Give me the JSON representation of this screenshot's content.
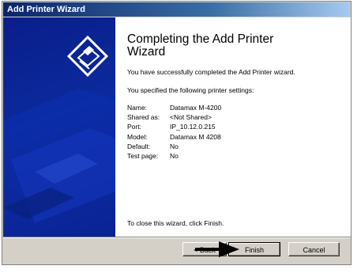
{
  "window": {
    "title": "Add Printer Wizard"
  },
  "heading_line1": "Completing the Add Printer",
  "heading_line2": "Wizard",
  "intro": "You have successfully completed the Add Printer wizard.",
  "specified": "You specified the following printer settings:",
  "settings": [
    {
      "label": "Name:",
      "value": "Datamax M-4200"
    },
    {
      "label": "Shared as:",
      "value": "<Not Shared>"
    },
    {
      "label": "Port:",
      "value": "IP_10.12.0.215"
    },
    {
      "label": "Model:",
      "value": "Datamax M 4208"
    },
    {
      "label": "Default:",
      "value": "No"
    },
    {
      "label": "Test page:",
      "value": "No"
    }
  ],
  "closing": "To close this wizard, click Finish.",
  "buttons": {
    "back": "< Back",
    "finish": "Finish",
    "cancel": "Cancel"
  },
  "colors": {
    "sidebar": "#0b2a9e",
    "titlebar": "#0a246a"
  }
}
